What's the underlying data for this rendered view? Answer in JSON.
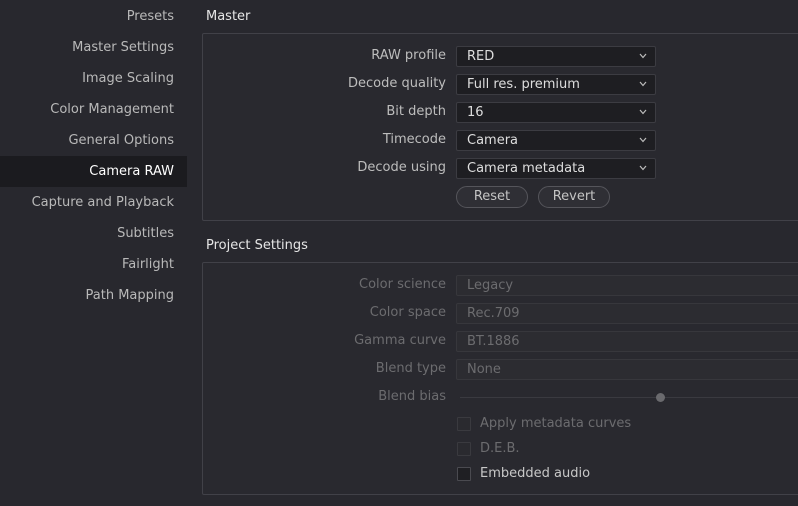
{
  "sidebar": {
    "items": [
      {
        "label": "Presets",
        "active": false
      },
      {
        "label": "Master Settings",
        "active": false
      },
      {
        "label": "Image Scaling",
        "active": false
      },
      {
        "label": "Color Management",
        "active": false
      },
      {
        "label": "General Options",
        "active": false
      },
      {
        "label": "Camera RAW",
        "active": true
      },
      {
        "label": "Capture and Playback",
        "active": false
      },
      {
        "label": "Subtitles",
        "active": false
      },
      {
        "label": "Fairlight",
        "active": false
      },
      {
        "label": "Path Mapping",
        "active": false
      }
    ]
  },
  "master": {
    "title": "Master",
    "fields": [
      {
        "label": "RAW profile",
        "value": "RED"
      },
      {
        "label": "Decode quality",
        "value": "Full res. premium"
      },
      {
        "label": "Bit depth",
        "value": "16"
      },
      {
        "label": "Timecode",
        "value": "Camera"
      },
      {
        "label": "Decode using",
        "value": "Camera metadata"
      }
    ],
    "reset_label": "Reset",
    "revert_label": "Revert"
  },
  "project": {
    "title": "Project Settings",
    "fields": [
      {
        "label": "Color science",
        "value": "Legacy"
      },
      {
        "label": "Color space",
        "value": "Rec.709"
      },
      {
        "label": "Gamma curve",
        "value": "BT.1886"
      },
      {
        "label": "Blend type",
        "value": "None"
      }
    ],
    "blend_bias_label": "Blend bias",
    "checkboxes": [
      {
        "label": "Apply metadata curves",
        "checked": false,
        "enabled": false
      },
      {
        "label": "D.E.B.",
        "checked": false,
        "enabled": false
      },
      {
        "label": "Embedded audio",
        "checked": false,
        "enabled": true
      }
    ]
  },
  "icons": {
    "dropdown": "chevron-down-icon"
  }
}
